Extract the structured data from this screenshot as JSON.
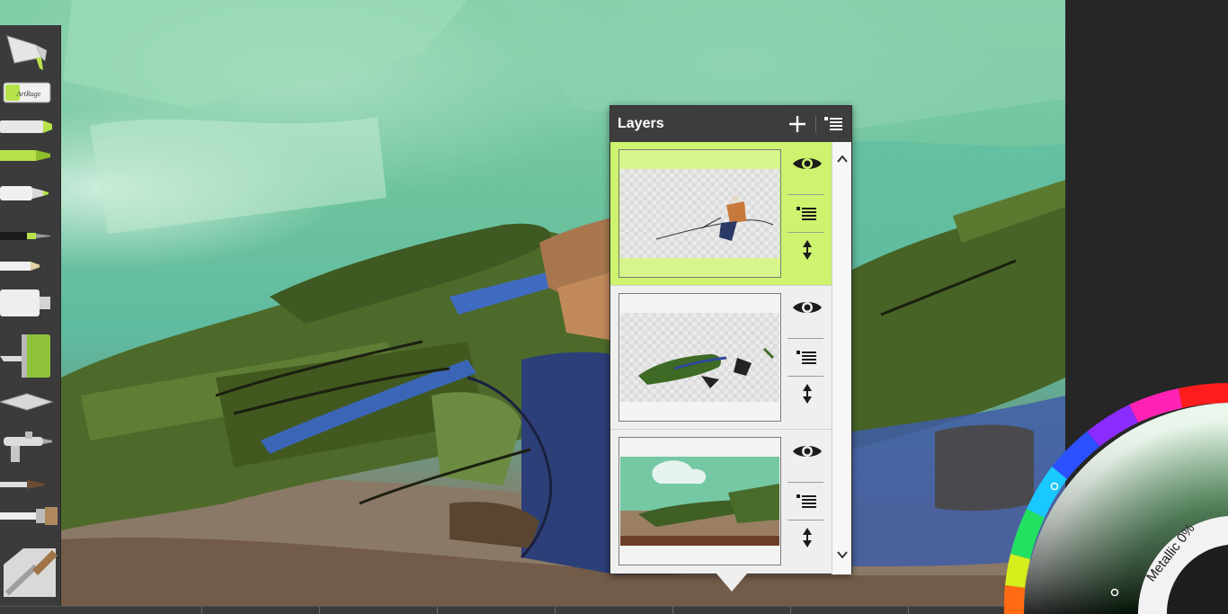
{
  "app": {
    "name": "ArtRage",
    "canvas_bg": "#6cc29e"
  },
  "toolbar": {
    "tools": [
      {
        "name": "paint-tube-tool",
        "label": ""
      },
      {
        "name": "sticker-tool",
        "label": "ArtRage"
      },
      {
        "name": "chalk-tool",
        "label": ""
      },
      {
        "name": "felt-pen-tool",
        "label": ""
      },
      {
        "name": "marker-tool",
        "label": ""
      },
      {
        "name": "ink-pen-tool",
        "label": ""
      },
      {
        "name": "pencil-tool",
        "label": ""
      },
      {
        "name": "glitter-tube-tool",
        "label": ""
      },
      {
        "name": "paint-roller-tool",
        "label": ""
      },
      {
        "name": "palette-knife-tool",
        "label": ""
      },
      {
        "name": "airbrush-tool",
        "label": ""
      },
      {
        "name": "watercolor-brush-tool",
        "label": ""
      },
      {
        "name": "flat-brush-tool",
        "label": ""
      },
      {
        "name": "oil-brush-tool",
        "label": ""
      }
    ],
    "accent": "#b7e24a"
  },
  "layers_panel": {
    "title": "Layers",
    "icons": {
      "add": "plus-icon",
      "menu": "layer-menu-icon"
    },
    "selected_color": "#cdf36f",
    "layers": [
      {
        "id": "layer-1",
        "selected": true,
        "visible": true
      },
      {
        "id": "layer-2",
        "selected": false,
        "visible": true
      },
      {
        "id": "layer-3",
        "selected": false,
        "visible": true
      }
    ]
  },
  "color_picker": {
    "metallic_label": "Metallic 0%",
    "metallic": 0,
    "current_color": "#0f2a12"
  }
}
